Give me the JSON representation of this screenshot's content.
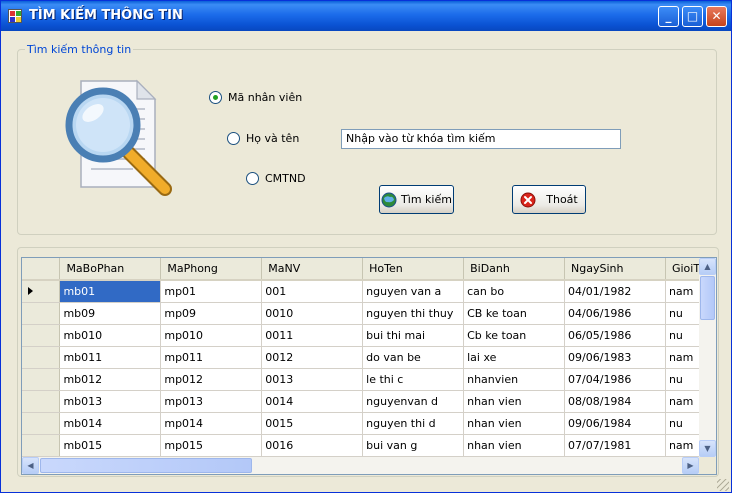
{
  "window": {
    "title": "TÌM KIẾM THÔNG TIN",
    "minimize": "_",
    "maximize": "□",
    "close": "✕"
  },
  "search": {
    "group_title": "Tìm kiếm thông tin",
    "options": [
      {
        "label": "Mã nhân viên",
        "checked": true
      },
      {
        "label": "Họ và tên",
        "checked": false
      },
      {
        "label": "CMTND",
        "checked": false
      }
    ],
    "keyword_value": "Nhập vào từ khóa tìm kiếm",
    "search_button": "Tìm kiếm",
    "exit_button": "Thoát",
    "illustration_icon": "document-magnifier-icon"
  },
  "grid": {
    "columns": [
      "MaBoPhan",
      "MaPhong",
      "MaNV",
      "HoTen",
      "BiDanh",
      "NgaySinh",
      "GioiTin"
    ],
    "rows": [
      [
        "mb01",
        "mp01",
        "001",
        "nguyen van a",
        "can bo",
        "04/01/1982",
        "nam"
      ],
      [
        "mb09",
        "mp09",
        "0010",
        "nguyen thi thuy",
        "CB ke toan",
        "04/06/1986",
        "nu"
      ],
      [
        "mb010",
        "mp010",
        "0011",
        "bui thi mai",
        "Cb ke toan",
        "06/05/1986",
        "nu"
      ],
      [
        "mb011",
        "mp011",
        "0012",
        "do van be",
        "lai xe",
        "09/06/1983",
        "nam"
      ],
      [
        "mb012",
        "mp012",
        "0013",
        "le thi c",
        "nhanvien",
        "07/04/1986",
        "nu"
      ],
      [
        "mb013",
        "mp013",
        "0014",
        "nguyenvan d",
        "nhan vien",
        "08/08/1984",
        "nam"
      ],
      [
        "mb014",
        "mp014",
        "0015",
        "nguyen thi d",
        "nhan vien",
        "09/06/1984",
        "nu"
      ],
      [
        "mb015",
        "mp015",
        "0016",
        "bui van g",
        "nhan vien",
        "07/07/1981",
        "nam"
      ]
    ],
    "selected_row": 0
  },
  "colors": {
    "title_bar": "#0a52d3",
    "selection": "#316ac5",
    "group_title": "#0046d5"
  }
}
